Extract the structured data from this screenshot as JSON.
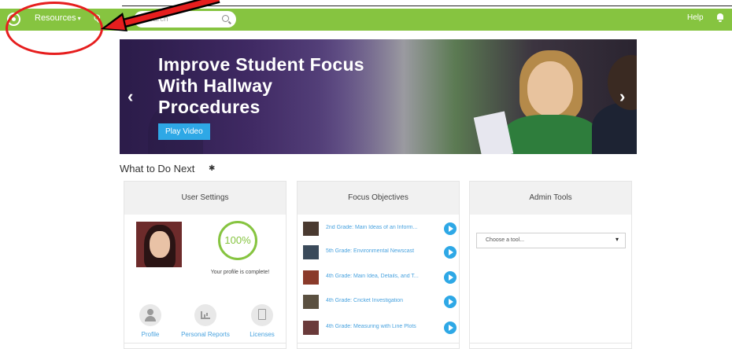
{
  "nav": {
    "resources_label": "Resources",
    "resources_caret": "▾",
    "q_label": "Q",
    "search_placeholder": "Search",
    "help_label": "Help"
  },
  "banner": {
    "title_line1": "Improve Student Focus",
    "title_line2": "With Hallway",
    "title_line3": "Procedures",
    "play_label": "Play Video"
  },
  "section": {
    "title": "What to Do Next"
  },
  "user_settings": {
    "title": "User Settings",
    "progress": "100%",
    "status": "Your profile is complete!",
    "links": [
      "Profile",
      "Personal Reports",
      "Licenses"
    ]
  },
  "focus_objectives": {
    "title": "Focus Objectives",
    "items": [
      "2nd Grade: Main Ideas of an Inform...",
      "5th Grade: Environmental Newscast",
      "4th Grade: Main Idea, Details, and T...",
      "4th Grade: Cricket Investigation",
      "4th Grade: Measuring with Line Plots"
    ]
  },
  "admin_tools": {
    "title": "Admin Tools",
    "select_value": "Choose a tool..."
  },
  "colors": {
    "nav_green": "#86c440",
    "accent_blue": "#2ea8e6",
    "annotation_red": "#e61e1e"
  }
}
